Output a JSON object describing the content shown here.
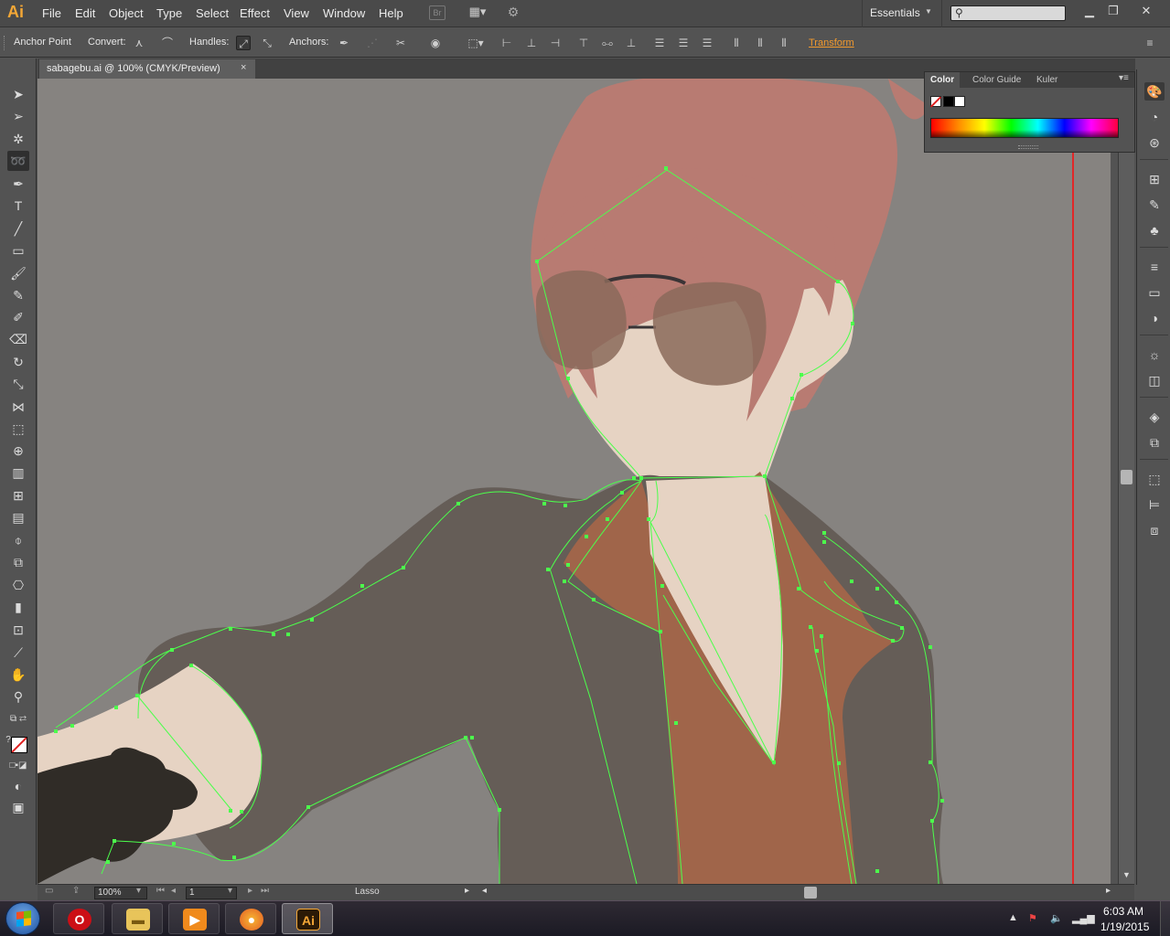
{
  "menubar": {
    "logo": "Ai",
    "items": [
      "File",
      "Edit",
      "Object",
      "Type",
      "Select",
      "Effect",
      "View",
      "Window",
      "Help"
    ],
    "bridge": "Br",
    "workspace": "Essentials",
    "search_placeholder": ""
  },
  "controlbar": {
    "selection_label": "Anchor Point",
    "convert_label": "Convert:",
    "handles_label": "Handles:",
    "anchors_label": "Anchors:",
    "transform_link": "Transform"
  },
  "document": {
    "tab_title": "sabagebu.ai @ 100% (CMYK/Preview)",
    "close": "×"
  },
  "statusbar": {
    "zoom": "100%",
    "artboard": "1",
    "current_tool": "Lasso"
  },
  "color_panel": {
    "tabs": [
      "Color",
      "Color Guide",
      "Kuler"
    ],
    "active_tab": "Color"
  },
  "toolbar": {
    "active_tool": "lasso-tool"
  },
  "taskbar": {
    "apps": [
      "opera",
      "file-explorer",
      "media-player",
      "firefox",
      "illustrator"
    ],
    "active_app": "illustrator",
    "illustrator_label": "Ai",
    "time": "6:03 AM",
    "date": "1/19/2015"
  },
  "colors": {
    "accent": "#f29a2e",
    "selection_path": "#4cff4c",
    "hair": "#b87b72",
    "skin": "#e6d3c3",
    "jacket": "#655d57",
    "shirt": "#a0654a",
    "glove": "#302c27",
    "lens": "#8a6a5a",
    "canvas_bg": "#868380"
  }
}
